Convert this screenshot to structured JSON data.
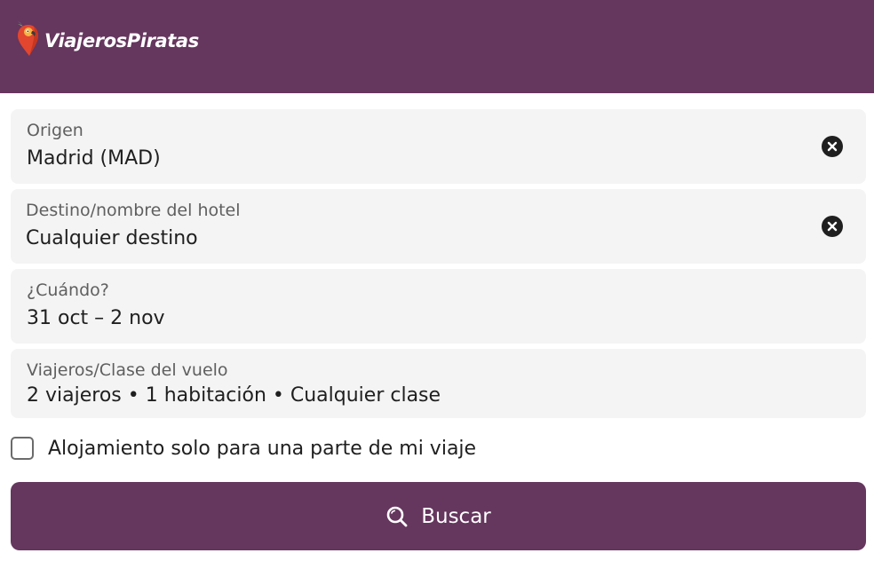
{
  "header": {
    "logo_text": "ViajerosPiratas",
    "background": "#65365e",
    "logo_icon": "parrot-pin-icon"
  },
  "form": {
    "origin": {
      "label": "Origen",
      "value": "Madrid (MAD)",
      "clear_icon": "close-circle-icon"
    },
    "destination": {
      "label": "Destino/nombre del hotel",
      "value": "Cualquier destino",
      "clear_icon": "close-circle-icon"
    },
    "dates": {
      "label": "¿Cuándo?",
      "value": "31 oct – 2 nov"
    },
    "travelers": {
      "label": "Viajeros/Clase del vuelo",
      "value": "2 viajeros • 1 habitación • Cualquier clase"
    },
    "partial_stay": {
      "label": "Alojamiento solo para una parte de mi viaje",
      "checked": false
    },
    "search_button": {
      "label": "Buscar",
      "icon": "search-icon"
    }
  },
  "colors": {
    "brand": "#65365e",
    "field_background": "#f4f4f4",
    "text": "#1f1f1f"
  }
}
